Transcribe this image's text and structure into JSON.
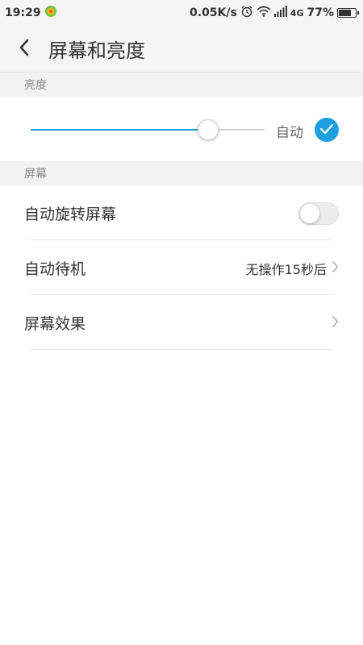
{
  "status_bar": {
    "time": "19:29",
    "net_speed": "0.05K/s",
    "network": "4G",
    "battery": "77%",
    "battery_level": 0.77,
    "icons": [
      "app-notification-icon",
      "alarm-icon",
      "wifi-icon",
      "signal-icon",
      "battery-icon"
    ]
  },
  "header": {
    "title": "屏幕和亮度",
    "back_icon": "back-arrow-icon"
  },
  "brightness": {
    "section_title": "亮度",
    "level": 0.76,
    "auto_label": "自动",
    "auto_checked": true
  },
  "screen": {
    "section_title": "屏幕",
    "items": [
      {
        "label": "自动旋转屏幕",
        "type": "toggle",
        "on": false
      },
      {
        "label": "自动待机",
        "type": "link",
        "value": "无操作15秒后"
      },
      {
        "label": "屏幕效果",
        "type": "link",
        "value": ""
      }
    ]
  },
  "colors": {
    "accent": "#1e9fe0",
    "background": "#ffffff",
    "section_bg": "#f2f2f2"
  }
}
